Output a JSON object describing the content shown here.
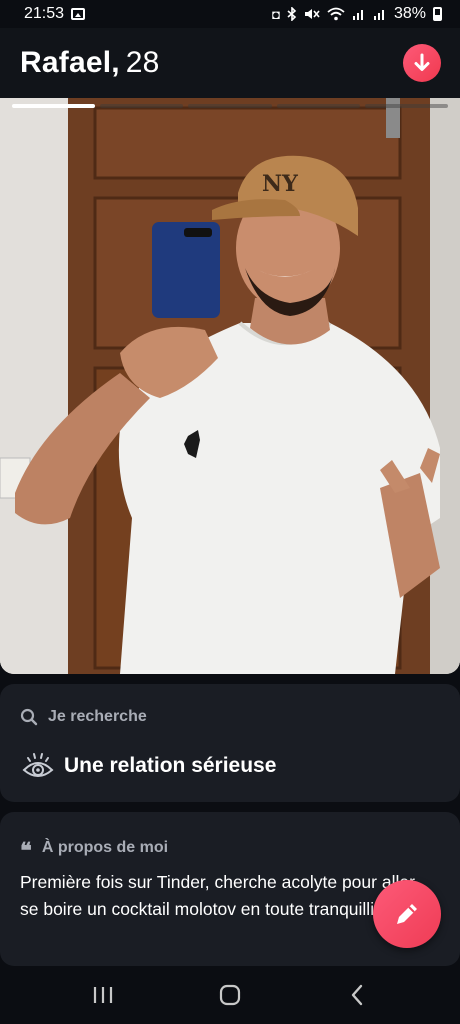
{
  "status_bar": {
    "time": "21:53",
    "battery": "38%",
    "icons": [
      "gallery-icon",
      "data-saver-icon",
      "bluetooth-icon",
      "mute-icon",
      "wifi-icon",
      "signal-icon",
      "signal-icon",
      "battery-icon"
    ]
  },
  "header": {
    "name": "Rafael,",
    "age": "28",
    "collapse_icon": "arrow-down-icon",
    "accent_color": "#fd4b66"
  },
  "photo": {
    "count": 5,
    "active_index": 0
  },
  "looking_for": {
    "heading": "Je recherche",
    "heading_icon": "search-icon",
    "value": "Une relation sérieuse",
    "value_icon": "eye-icon"
  },
  "about": {
    "heading": "À propos de moi",
    "heading_icon": "quote-icon",
    "quote_glyph": "❝",
    "text": "Première fois sur Tinder, cherche acolyte pour aller se boire un cocktail molotov en toute tranquillité 🍹"
  },
  "edit_button": {
    "icon": "pencil-icon"
  },
  "nav_bar": {
    "items": [
      "recent-apps-icon",
      "home-icon",
      "back-icon"
    ]
  }
}
